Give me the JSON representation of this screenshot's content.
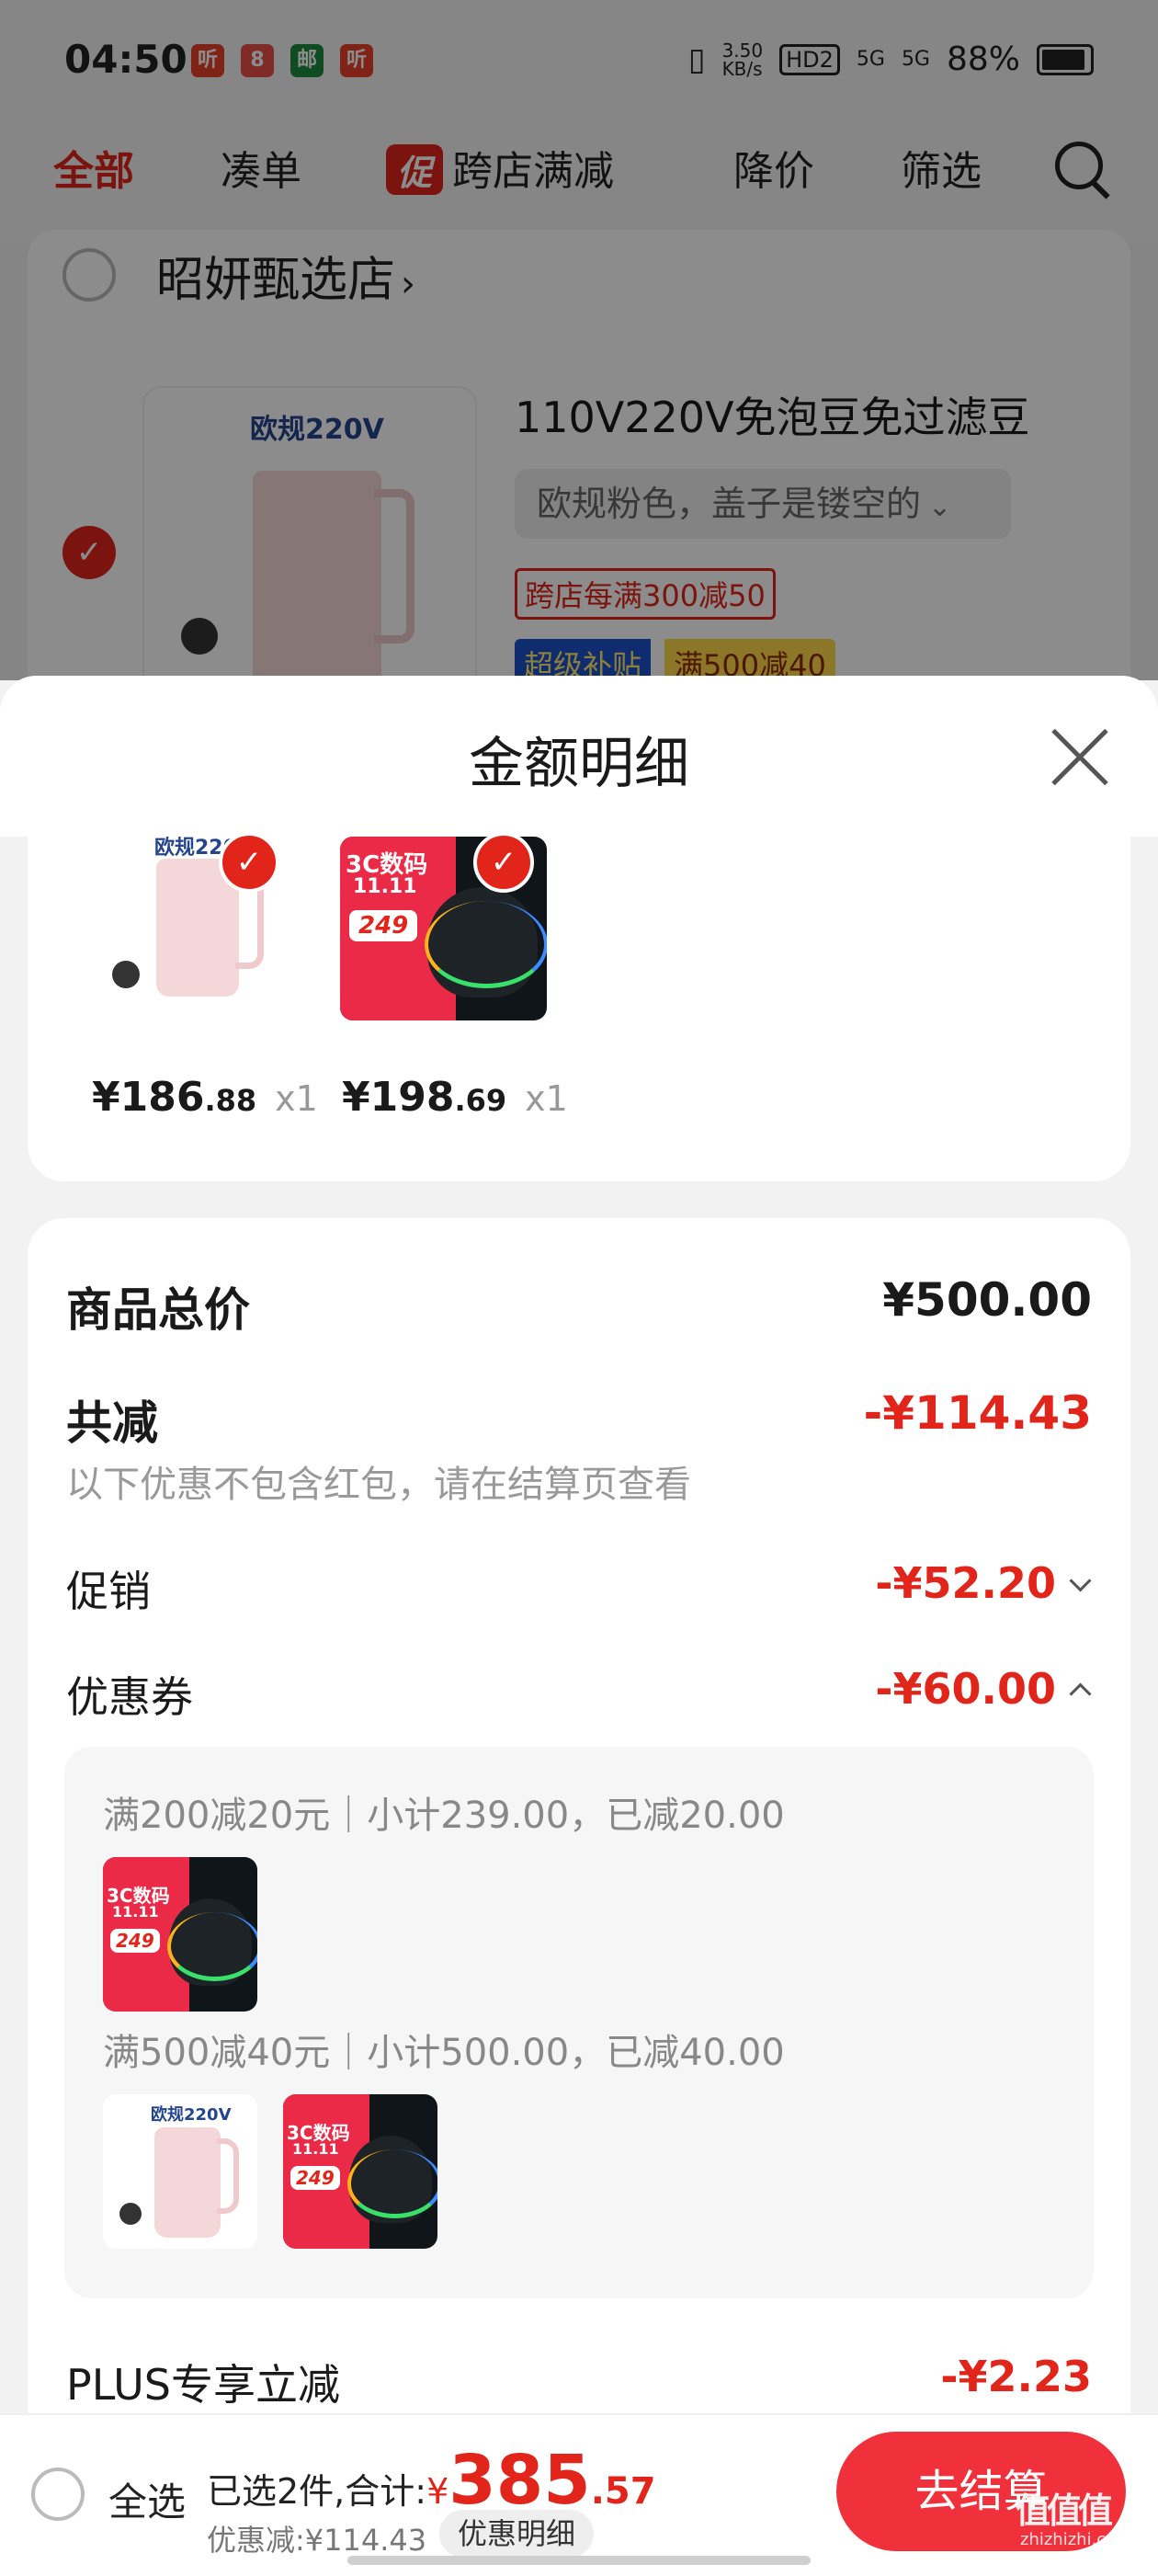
{
  "status_bar": {
    "time": "04:50",
    "app_icons": [
      "听",
      "8",
      "邮",
      "听"
    ],
    "speed": "3.50\nKB/s",
    "hd": "HD2",
    "net1": "5G",
    "net2": "5G",
    "battery": "88%"
  },
  "tabs": {
    "all": "全部",
    "bundle": "凑单",
    "promo_badge": "促",
    "cross_store": "跨店满减",
    "price_drop": "降价",
    "filter": "筛选"
  },
  "cart": {
    "store_name": "昭妍甄选店",
    "store_chevron": "›",
    "product_title": "110V220V免泡豆免过滤豆",
    "variant": "欧规粉色，盖子是镂空的",
    "variant_chevron": "⌄",
    "tag_cross_store": "跨店每满300减50",
    "tag_subsidy": "超级补贴",
    "tag_discount": "满500减40",
    "image_label": "欧规220V"
  },
  "sheet": {
    "title": "金额明细",
    "items": [
      {
        "image_label": "欧规220V",
        "price_int": "¥186",
        "price_dec": ".88",
        "qty": "x1"
      },
      {
        "image_label": "3C数码",
        "image_sub": "11.11",
        "image_price": "249",
        "price_int": "¥198",
        "price_dec": ".69",
        "qty": "x1"
      }
    ],
    "total_label": "商品总价",
    "total_value": "¥500.00",
    "reduce_label": "共减",
    "reduce_value": "-¥114.43",
    "reduce_note": "以下优惠不包含红包，请在结算页查看",
    "promo_label": "促销",
    "promo_value": "-¥52.20",
    "coupon_label": "优惠券",
    "coupon_value": "-¥60.00",
    "coupon_groups": [
      {
        "desc": "满200减20元｜小计239.00，已减20.00"
      },
      {
        "desc": "满500减40元｜小计500.00，已减40.00"
      }
    ],
    "plus_label": "PLUS专享立减",
    "plus_value": "-¥2.23"
  },
  "bottom_bar": {
    "select_all": "全选",
    "summary_prefix": "已选2件,合计:",
    "total_symbol": "¥",
    "total_int": "385",
    "total_dec": ".57",
    "discount_line": "优惠减:¥114.43",
    "detail_button": "优惠明细",
    "checkout_button": "去结算"
  },
  "watermark": {
    "text": "值值值",
    "sub": "zhizhizhi.com"
  },
  "colors": {
    "accent": "#e1251b",
    "checkout": "#f0303a"
  }
}
